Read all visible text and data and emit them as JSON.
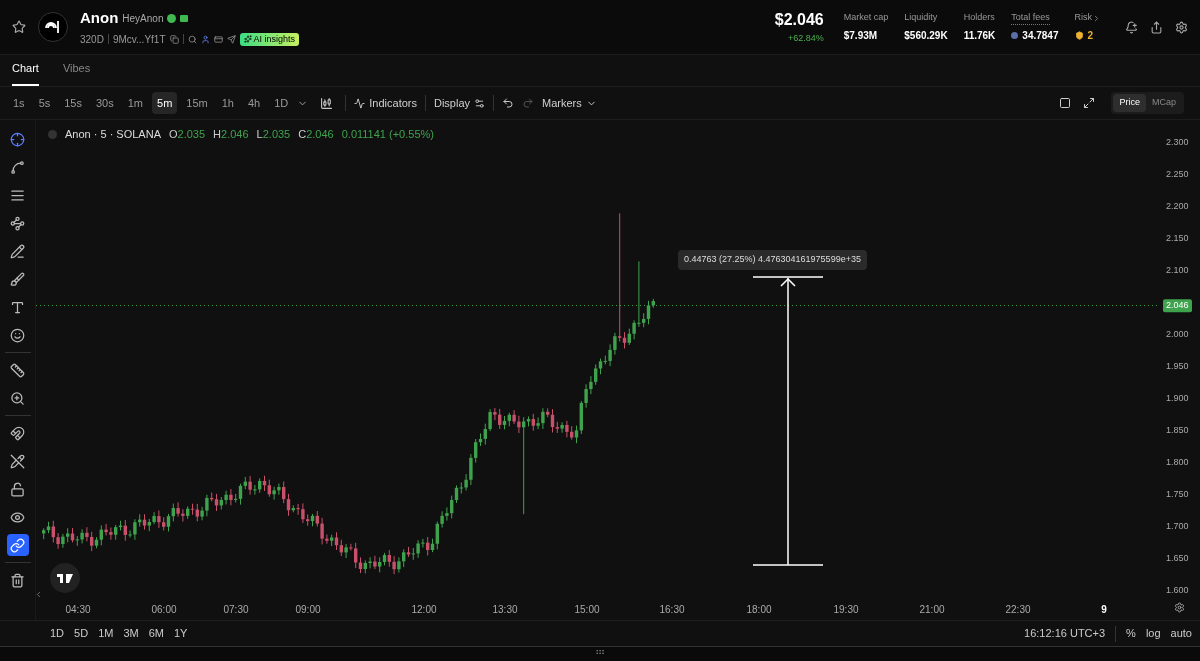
{
  "header": {
    "token_name": "Anon",
    "handle": "HeyAnon",
    "age": "320D",
    "address": "9Mcv...Yf1T",
    "ai_badge": "AI insights",
    "price": "$2.046",
    "change": "+62.84%",
    "stats": [
      {
        "kind": "plain",
        "label": "Market cap",
        "value": "$7.93M"
      },
      {
        "kind": "plain",
        "label": "Liquidity",
        "value": "$560.29K"
      },
      {
        "kind": "plain",
        "label": "Holders",
        "value": "11.76K"
      },
      {
        "kind": "fees",
        "label": "Total fees",
        "value": "34.7847"
      },
      {
        "kind": "risk",
        "label": "Risk",
        "value": "2"
      }
    ]
  },
  "tabs": [
    {
      "label": "Chart",
      "selected": true
    },
    {
      "label": "Vibes",
      "selected": false
    }
  ],
  "intervals": [
    {
      "label": "1s",
      "selected": false
    },
    {
      "label": "5s",
      "selected": false
    },
    {
      "label": "15s",
      "selected": false
    },
    {
      "label": "30s",
      "selected": false
    },
    {
      "label": "1m",
      "selected": false
    },
    {
      "label": "5m",
      "selected": true
    },
    {
      "label": "15m",
      "selected": false
    },
    {
      "label": "1h",
      "selected": false
    },
    {
      "label": "4h",
      "selected": false
    },
    {
      "label": "1D",
      "selected": false
    }
  ],
  "toolbar": {
    "indicators": "Indicators",
    "display": "Display",
    "markers": "Markers"
  },
  "value_toggle": [
    {
      "label": "Price",
      "selected": true
    },
    {
      "label": "MCap",
      "selected": false
    }
  ],
  "legend": {
    "symbol": "Anon · 5 · SOLANA",
    "ohlc": [
      {
        "key": "O",
        "value": "2.035"
      },
      {
        "key": "H",
        "value": "2.046"
      },
      {
        "key": "L",
        "value": "2.035"
      },
      {
        "key": "C",
        "value": "2.046"
      }
    ],
    "change": "0.011141 (+0.55%)"
  },
  "tools": [
    {
      "kind": "crosshair",
      "active": true
    },
    {
      "kind": "line",
      "active": false
    },
    {
      "kind": "fib",
      "active": false
    },
    {
      "kind": "pattern",
      "active": false
    },
    {
      "kind": "projection",
      "active": false
    },
    {
      "kind": "brush",
      "active": false
    },
    {
      "kind": "text",
      "active": false
    },
    {
      "kind": "emoji",
      "active": false
    },
    {
      "kind": "ruler",
      "active": false
    },
    {
      "kind": "zoom",
      "active": false
    },
    {
      "kind": "magnet",
      "active": false
    },
    {
      "kind": "lockdraw",
      "active": false
    },
    {
      "kind": "lock",
      "active": false
    },
    {
      "kind": "eye",
      "active": false
    },
    {
      "kind": "link",
      "active": true
    },
    {
      "kind": "trash",
      "active": false
    }
  ],
  "price_ticks": [
    "2.300",
    "2.250",
    "2.200",
    "2.150",
    "2.100",
    "2.000",
    "1.950",
    "1.900",
    "1.850",
    "1.800",
    "1.750",
    "1.700",
    "1.650",
    "1.600"
  ],
  "current_price": "2.046",
  "time_ticks": [
    {
      "label": "04:30",
      "kind": "time"
    },
    {
      "label": "06:00",
      "kind": "time"
    },
    {
      "label": "07:30",
      "kind": "time"
    },
    {
      "label": "09:00",
      "kind": "time"
    },
    {
      "label": "12:00",
      "kind": "time"
    },
    {
      "label": "13:30",
      "kind": "time"
    },
    {
      "label": "15:00",
      "kind": "time"
    },
    {
      "label": "16:30",
      "kind": "time"
    },
    {
      "label": "18:00",
      "kind": "time"
    },
    {
      "label": "19:30",
      "kind": "time"
    },
    {
      "label": "21:00",
      "kind": "time"
    },
    {
      "label": "22:30",
      "kind": "time"
    },
    {
      "label": "9",
      "kind": "day"
    }
  ],
  "measure_label": "0.44763 (27.25%) 4.476304161975599e+35",
  "ranges": [
    "1D",
    "5D",
    "1M",
    "3M",
    "6M",
    "1Y"
  ],
  "footer": {
    "clock": "16:12:16 UTC+3",
    "percent": "%",
    "log": "log",
    "auto": "auto"
  }
}
